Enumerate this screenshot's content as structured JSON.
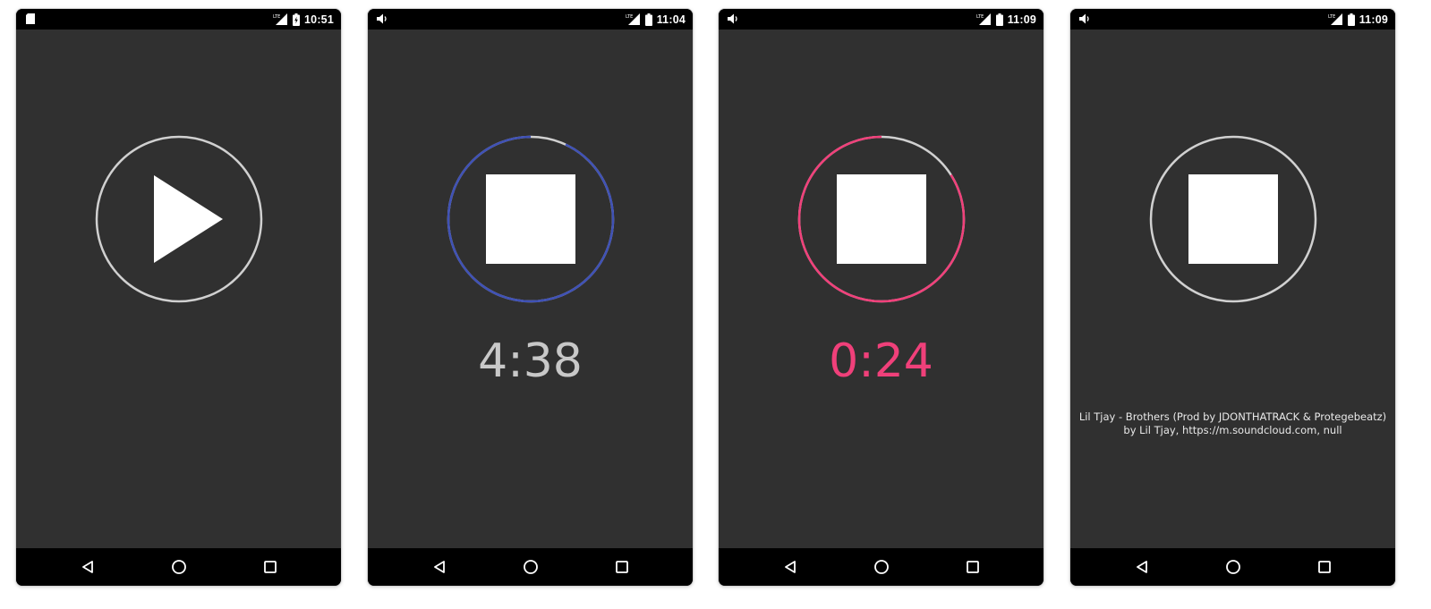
{
  "colors": {
    "background": "#303030",
    "bar": "#000000",
    "ring_idle": "#d0d0d0",
    "ring_blue": "#3f51b5",
    "ring_pink": "#f0407a",
    "timer_gray": "#c8c8c8",
    "timer_pink": "#f0407a"
  },
  "screens": [
    {
      "status": {
        "left_icon": "sd-card-icon",
        "time": "10:51",
        "battery": "battery-charging-icon"
      },
      "control": "play",
      "ring": {
        "color": "#d0d0d0",
        "progress": 0
      },
      "timer": {
        "text": "",
        "color": ""
      },
      "track": {
        "line1": "",
        "line2": ""
      }
    },
    {
      "status": {
        "left_icon": "volume-icon",
        "time": "11:04",
        "battery": "battery-icon"
      },
      "control": "stop",
      "ring": {
        "color": "#3f51b5",
        "progress": 0.93
      },
      "timer": {
        "text": "4:38",
        "color": "#c8c8c8"
      },
      "track": {
        "line1": "",
        "line2": ""
      }
    },
    {
      "status": {
        "left_icon": "volume-icon",
        "time": "11:09",
        "battery": "battery-icon"
      },
      "control": "stop",
      "ring": {
        "color": "#f0407a",
        "progress": 0.84
      },
      "timer": {
        "text": "0:24",
        "color": "#f0407a"
      },
      "track": {
        "line1": "",
        "line2": ""
      }
    },
    {
      "status": {
        "left_icon": "volume-icon",
        "time": "11:09",
        "battery": "battery-icon"
      },
      "control": "stop",
      "ring": {
        "color": "#d0d0d0",
        "progress": 0
      },
      "timer": {
        "text": "",
        "color": ""
      },
      "track": {
        "line1": "Lil Tjay - Brothers (Prod by JDONTHATRACK & Protegebeatz)",
        "line2": "by Lil Tjay, https://m.soundcloud.com, null"
      }
    }
  ]
}
